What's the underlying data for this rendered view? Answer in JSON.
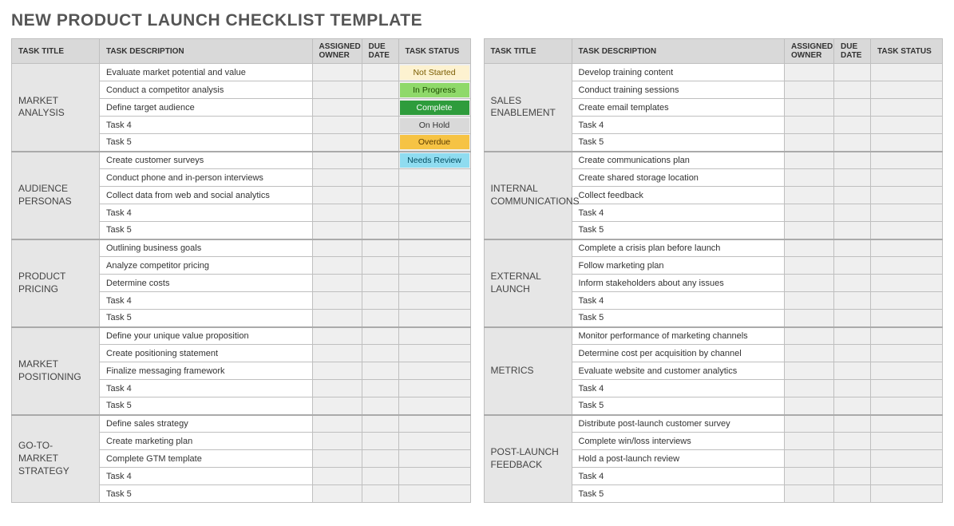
{
  "title": "NEW PRODUCT LAUNCH CHECKLIST TEMPLATE",
  "headers": {
    "task_title": "TASK TITLE",
    "task_description": "TASK DESCRIPTION",
    "assigned_owner": "ASSIGNED OWNER",
    "due_date": "DUE DATE",
    "task_status": "TASK STATUS"
  },
  "status_labels": {
    "notstarted": "Not Started",
    "inprogress": "In Progress",
    "complete": "Complete",
    "onhold": "On Hold",
    "overdue": "Overdue",
    "needsreview": "Needs Review"
  },
  "left_sections": [
    {
      "name": "MARKET ANALYSIS",
      "tasks": [
        {
          "desc": "Evaluate market potential and value",
          "status": "notstarted"
        },
        {
          "desc": "Conduct a competitor analysis",
          "status": "inprogress"
        },
        {
          "desc": "Define target audience",
          "status": "complete"
        },
        {
          "desc": "Task 4",
          "status": "onhold"
        },
        {
          "desc": "Task 5",
          "status": "overdue"
        }
      ]
    },
    {
      "name": "AUDIENCE PERSONAS",
      "tasks": [
        {
          "desc": "Create customer surveys",
          "status": "needsreview"
        },
        {
          "desc": "Conduct phone and in-person interviews",
          "status": ""
        },
        {
          "desc": "Collect data from web and social analytics",
          "status": ""
        },
        {
          "desc": "Task 4",
          "status": ""
        },
        {
          "desc": "Task 5",
          "status": ""
        }
      ]
    },
    {
      "name": "PRODUCT PRICING",
      "tasks": [
        {
          "desc": "Outlining business goals",
          "status": ""
        },
        {
          "desc": "Analyze competitor pricing",
          "status": ""
        },
        {
          "desc": "Determine costs",
          "status": ""
        },
        {
          "desc": "Task 4",
          "status": ""
        },
        {
          "desc": "Task 5",
          "status": ""
        }
      ]
    },
    {
      "name": "MARKET POSITIONING",
      "tasks": [
        {
          "desc": "Define your unique value proposition",
          "status": ""
        },
        {
          "desc": "Create positioning statement",
          "status": ""
        },
        {
          "desc": "Finalize messaging framework",
          "status": ""
        },
        {
          "desc": "Task 4",
          "status": ""
        },
        {
          "desc": "Task 5",
          "status": ""
        }
      ]
    },
    {
      "name": "GO-TO-MARKET STRATEGY",
      "tasks": [
        {
          "desc": "Define sales strategy",
          "status": ""
        },
        {
          "desc": "Create marketing plan",
          "status": ""
        },
        {
          "desc": "Complete GTM template",
          "status": ""
        },
        {
          "desc": "Task 4",
          "status": ""
        },
        {
          "desc": "Task 5",
          "status": ""
        }
      ]
    }
  ],
  "right_sections": [
    {
      "name": "SALES ENABLEMENT",
      "tasks": [
        {
          "desc": "Develop training content",
          "status": ""
        },
        {
          "desc": "Conduct training sessions",
          "status": ""
        },
        {
          "desc": "Create email templates",
          "status": ""
        },
        {
          "desc": "Task 4",
          "status": ""
        },
        {
          "desc": "Task 5",
          "status": ""
        }
      ]
    },
    {
      "name": "INTERNAL COMMUNICATIONS",
      "tasks": [
        {
          "desc": "Create communications plan",
          "status": ""
        },
        {
          "desc": "Create shared storage location",
          "status": ""
        },
        {
          "desc": "Collect feedback",
          "status": ""
        },
        {
          "desc": "Task 4",
          "status": ""
        },
        {
          "desc": "Task 5",
          "status": ""
        }
      ]
    },
    {
      "name": "EXTERNAL LAUNCH",
      "tasks": [
        {
          "desc": "Complete a crisis plan before launch",
          "status": ""
        },
        {
          "desc": "Follow marketing plan",
          "status": ""
        },
        {
          "desc": "Inform stakeholders about any issues",
          "status": ""
        },
        {
          "desc": "Task 4",
          "status": ""
        },
        {
          "desc": "Task 5",
          "status": ""
        }
      ]
    },
    {
      "name": "METRICS",
      "tasks": [
        {
          "desc": "Monitor performance of marketing channels",
          "status": ""
        },
        {
          "desc": "Determine cost per acquisition by channel",
          "status": ""
        },
        {
          "desc": "Evaluate website and customer analytics",
          "status": ""
        },
        {
          "desc": "Task 4",
          "status": ""
        },
        {
          "desc": "Task 5",
          "status": ""
        }
      ]
    },
    {
      "name": "POST-LAUNCH FEEDBACK",
      "tasks": [
        {
          "desc": "Distribute post-launch customer survey",
          "status": ""
        },
        {
          "desc": "Complete win/loss interviews",
          "status": ""
        },
        {
          "desc": "Hold a post-launch review",
          "status": ""
        },
        {
          "desc": "Task 4",
          "status": ""
        },
        {
          "desc": "Task 5",
          "status": ""
        }
      ]
    }
  ]
}
